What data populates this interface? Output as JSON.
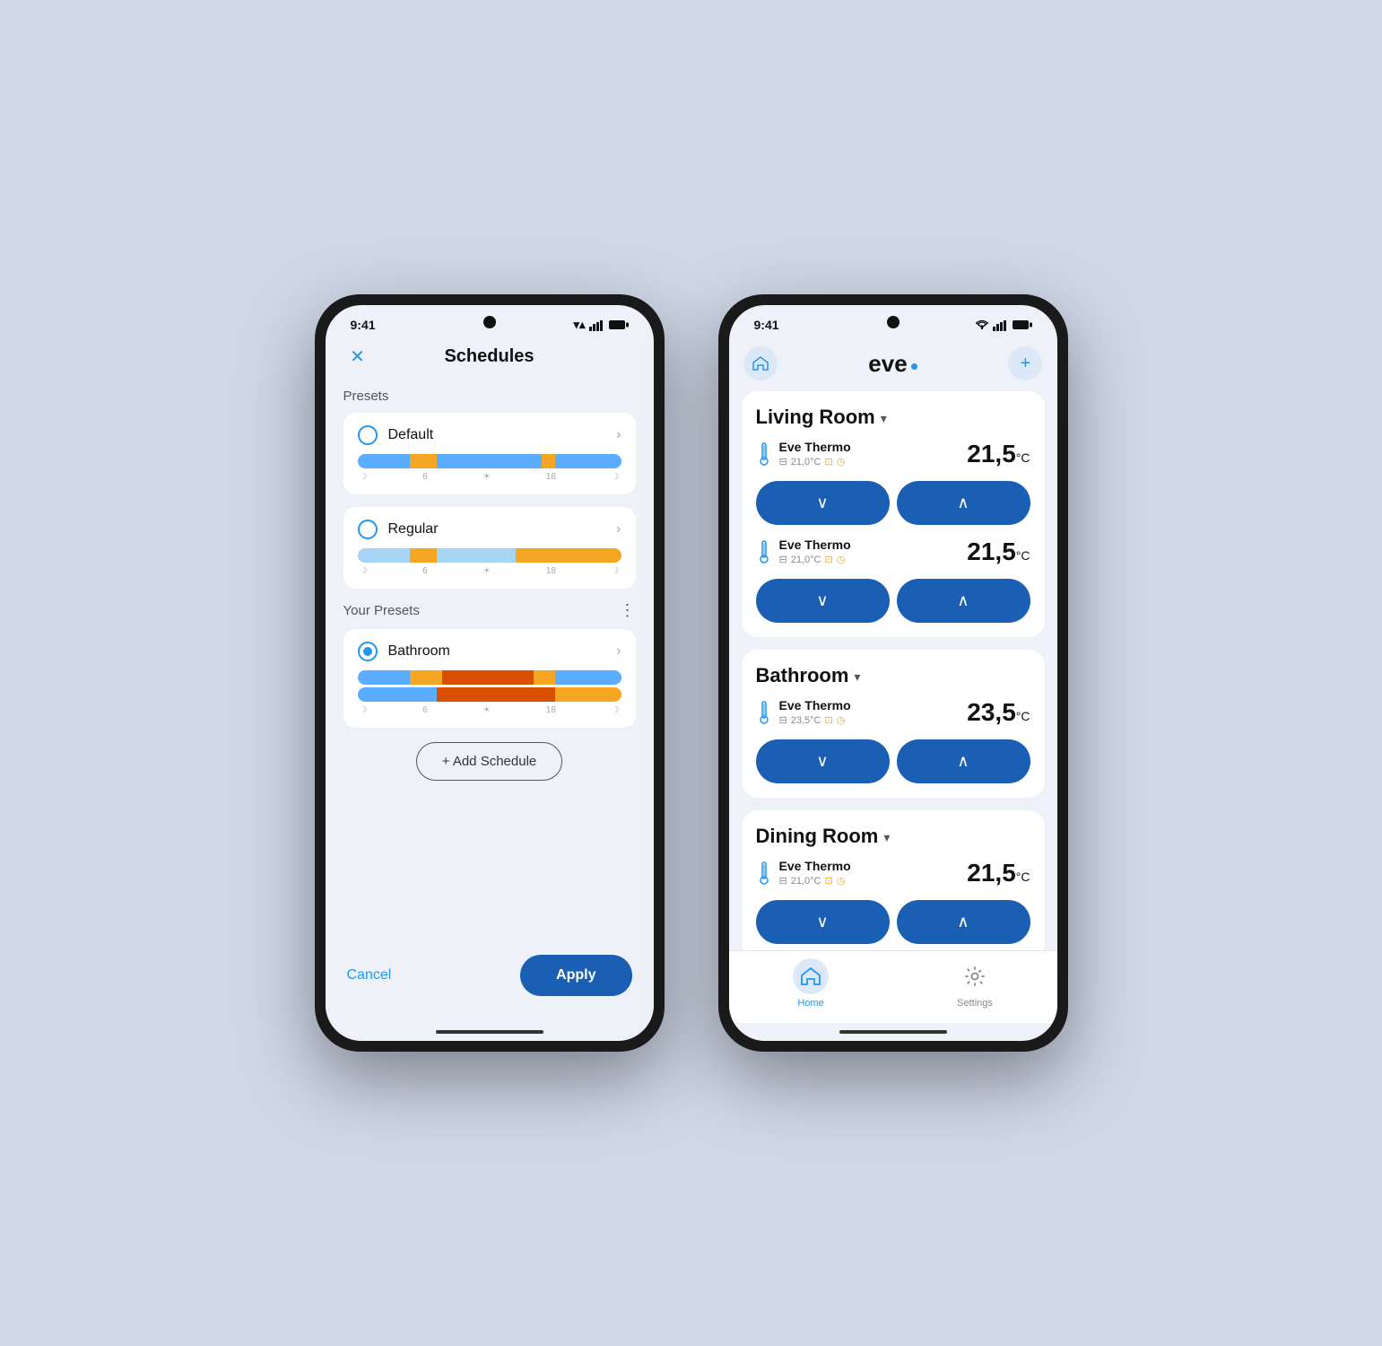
{
  "phone1": {
    "status_bar": {
      "time": "9:41",
      "wifi": "▼",
      "signal": [
        3,
        5,
        7,
        9,
        11
      ],
      "battery": "▮"
    },
    "header": {
      "title": "Schedules",
      "close_label": "✕"
    },
    "presets_section": {
      "label": "Presets",
      "items": [
        {
          "id": "default",
          "name": "Default",
          "selected": false,
          "bar": [
            {
              "color": "#5aadff",
              "flex": 20
            },
            {
              "color": "#f5a623",
              "flex": 10
            },
            {
              "color": "#5aadff",
              "flex": 40
            },
            {
              "color": "#f5a623",
              "flex": 5
            },
            {
              "color": "#5aadff",
              "flex": 25
            }
          ],
          "labels": [
            "☽",
            "6",
            "☀",
            "18",
            "☽"
          ]
        },
        {
          "id": "regular",
          "name": "Regular",
          "selected": false,
          "bar": [
            {
              "color": "#a8d4f5",
              "flex": 20
            },
            {
              "color": "#f5a623",
              "flex": 10
            },
            {
              "color": "#a8d4f5",
              "flex": 30
            },
            {
              "color": "#f5a623",
              "flex": 15
            },
            {
              "color": "#f5a623",
              "flex": 25
            }
          ],
          "labels": [
            "☽",
            "6",
            "☀",
            "18",
            "☽"
          ]
        }
      ]
    },
    "your_presets_section": {
      "label": "Your Presets",
      "dots_icon": "⋮",
      "items": [
        {
          "id": "bathroom",
          "name": "Bathroom",
          "selected": true,
          "bar_top": [
            {
              "color": "#5aadff",
              "flex": 20
            },
            {
              "color": "#f5a623",
              "flex": 12
            },
            {
              "color": "#d94f00",
              "flex": 35
            },
            {
              "color": "#f5a623",
              "flex": 8
            },
            {
              "color": "#5aadff",
              "flex": 25
            }
          ],
          "bar_bottom": [
            {
              "color": "#5aadff",
              "flex": 30
            },
            {
              "color": "#d94f00",
              "flex": 45
            },
            {
              "color": "#f5a623",
              "flex": 25
            }
          ],
          "labels": [
            "☽",
            "6",
            "☀",
            "18",
            "☽"
          ]
        }
      ]
    },
    "footer": {
      "cancel_label": "Cancel",
      "apply_label": "Apply"
    },
    "add_schedule": {
      "label": "+ Add Schedule"
    }
  },
  "phone2": {
    "status_bar": {
      "time": "9:41"
    },
    "header": {
      "logo": "eve",
      "home_icon": "⌂",
      "add_icon": "+"
    },
    "rooms": [
      {
        "id": "living-room",
        "name": "Living Room",
        "chevron": "▾",
        "devices": [
          {
            "name": "Eve Thermo",
            "status": "21,0°C",
            "status_icons": [
              "🔲",
              "⊡"
            ],
            "temp": "21,5",
            "unit": "°C"
          },
          {
            "name": "Eve Thermo",
            "status": "21,0°C",
            "status_icons": [
              "🔲",
              "⊡"
            ],
            "temp": "21,5",
            "unit": "°C"
          }
        ]
      },
      {
        "id": "bathroom",
        "name": "Bathroom",
        "chevron": "▾",
        "devices": [
          {
            "name": "Eve Thermo",
            "status": "23,5°C",
            "status_icons": [
              "🔲",
              "⊡"
            ],
            "temp": "23,5",
            "unit": "°C"
          }
        ]
      },
      {
        "id": "dining-room",
        "name": "Dining Room",
        "chevron": "▾",
        "devices": [
          {
            "name": "Eve Thermo",
            "status": "21,0°C",
            "status_icons": [
              "🔲",
              "⊡"
            ],
            "temp": "21,5",
            "unit": "°C"
          }
        ]
      }
    ],
    "tabs": [
      {
        "id": "home",
        "label": "Home",
        "icon": "⌂",
        "active": true
      },
      {
        "id": "settings",
        "label": "Settings",
        "icon": "⚙",
        "active": false
      }
    ],
    "ctrl_down": "∨",
    "ctrl_up": "∧"
  }
}
